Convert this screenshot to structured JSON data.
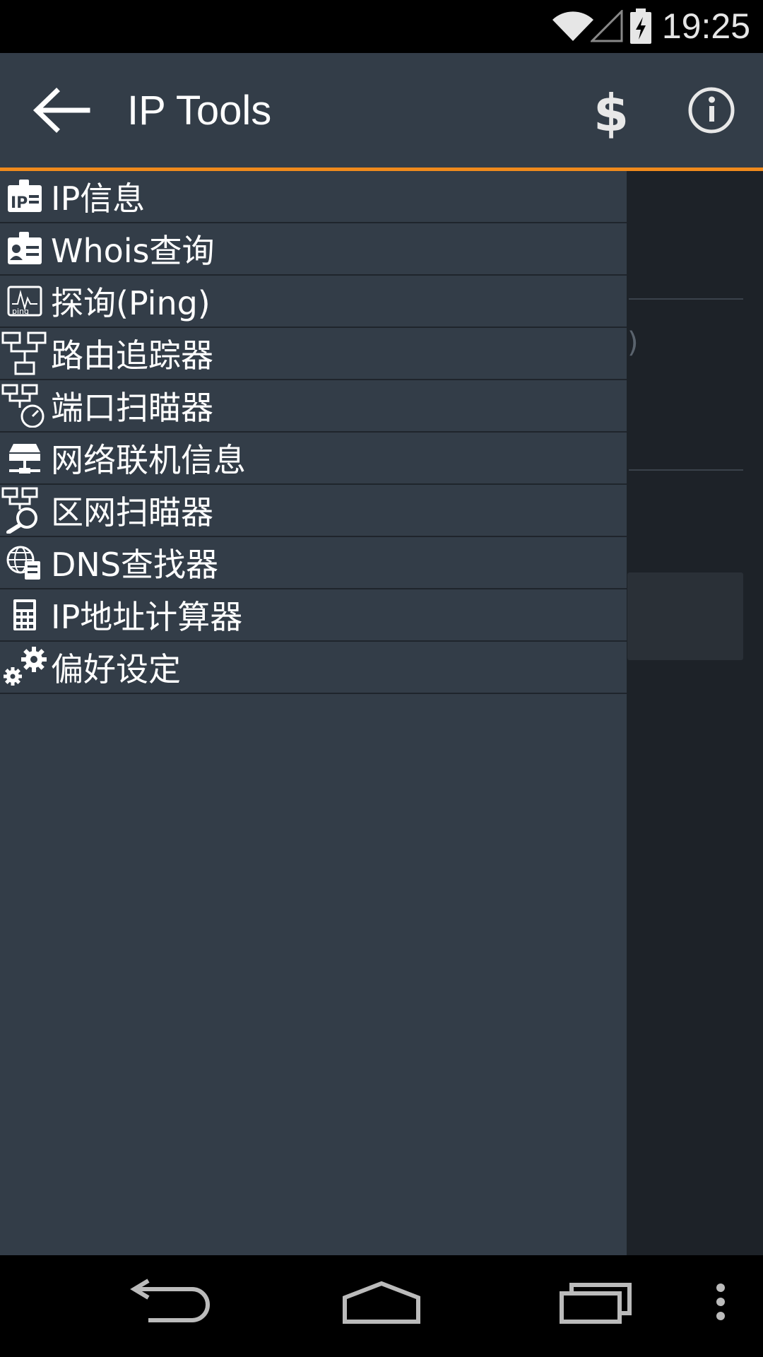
{
  "status_bar": {
    "time": "19:25"
  },
  "action_bar": {
    "title": "IP Tools",
    "accent_color": "#f08a1c",
    "back_icon": "arrow-left-icon",
    "donate_icon": "dollar-icon",
    "info_icon": "info-circle-icon"
  },
  "drawer": {
    "items": [
      {
        "label": "IP信息",
        "icon": "ip-card-icon"
      },
      {
        "label": "Whois查询",
        "icon": "id-card-icon"
      },
      {
        "label": "探询(Ping)",
        "icon": "ping-chart-icon"
      },
      {
        "label": "路由追踪器",
        "icon": "network-tree-icon"
      },
      {
        "label": "端口扫瞄器",
        "icon": "port-gauge-icon"
      },
      {
        "label": "网络联机信息",
        "icon": "server-icon"
      },
      {
        "label": "区网扫瞄器",
        "icon": "network-search-icon"
      },
      {
        "label": "DNS查找器",
        "icon": "globe-server-icon"
      },
      {
        "label": "IP地址计算器",
        "icon": "calculator-icon"
      },
      {
        "label": "偏好设定",
        "icon": "gears-icon"
      }
    ]
  },
  "navigation_bar": {
    "back": "nav-back-icon",
    "home": "nav-home-icon",
    "recents": "nav-recents-icon",
    "menu": "nav-menu-icon"
  }
}
